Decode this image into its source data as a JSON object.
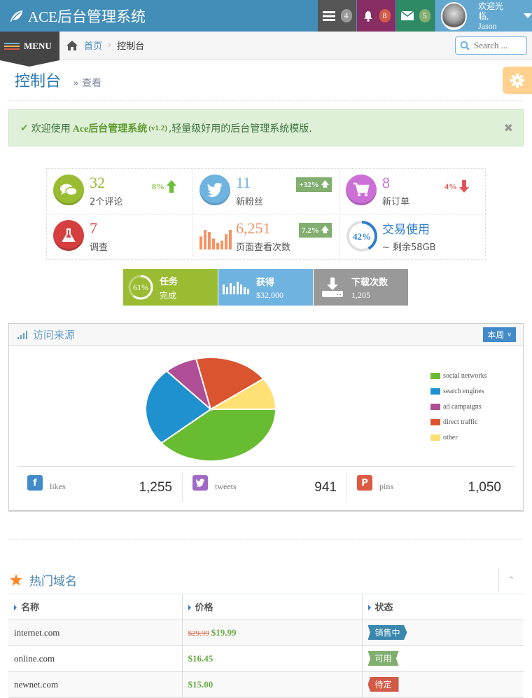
{
  "navbar": {
    "brand": "ACE后台管理系统",
    "tasks_count": "4",
    "notifications_count": "8",
    "messages_count": "5",
    "user_welcome": "欢迎光临,",
    "user_name": "Jason"
  },
  "sidebar": {
    "menu_label": "MENU"
  },
  "breadcrumb": {
    "home": "首页",
    "current": "控制台"
  },
  "search": {
    "placeholder": "Search ..."
  },
  "page_header": {
    "title": "控制台",
    "subtitle": "» 查看"
  },
  "alert": {
    "prefix": "欢迎使用",
    "brand": "Ace后台管理系统",
    "version": "(v1.2)",
    "suffix": ",轻量级好用的后台管理系统模版."
  },
  "infoboxes": [
    {
      "number": "32",
      "label": "2个评论",
      "stat": "8%",
      "trend": "up",
      "color": "#9abc32"
    },
    {
      "number": "11",
      "label": "新粉丝",
      "stat": "+32%",
      "trend": "up",
      "color": "#6fb3e0"
    },
    {
      "number": "8",
      "label": "新订单",
      "stat": "4%",
      "trend": "down",
      "color": "#cb6fd7"
    },
    {
      "number": "7",
      "label": "调查",
      "color": "#d53f40"
    },
    {
      "number": "6,251",
      "label": "页面查看次数",
      "stat": "7.2%",
      "trend": "up",
      "color": "#f79263",
      "sparkline": [
        6,
        9,
        8,
        5,
        3,
        4,
        7,
        9
      ]
    },
    {
      "title": "交易使用",
      "label": "~ 剩余58GB",
      "percent": "42%",
      "percent_value": 42,
      "color": "#307ecc"
    }
  ],
  "big_boxes": [
    {
      "title": "任务",
      "subtitle": "完成",
      "percent": "61%",
      "percent_value": 61,
      "color": "#9abc32"
    },
    {
      "title": "获得",
      "subtitle": "$32,000",
      "color": "#6fb3e0"
    },
    {
      "title": "下载次数",
      "subtitle": "1,205",
      "color": "#999999"
    }
  ],
  "traffic_widget": {
    "title": "访问来源",
    "range_button": "本周",
    "social": [
      {
        "label": "likes",
        "value": "1,255",
        "icon": "facebook-icon",
        "color": "#428bca"
      },
      {
        "label": "tweets",
        "value": "941",
        "icon": "twitter-icon",
        "color": "#a069c3"
      },
      {
        "label": "pins",
        "value": "1,050",
        "icon": "pinterest-icon",
        "color": "#dd5a43"
      }
    ]
  },
  "chart_data": {
    "type": "pie",
    "title": "访问来源",
    "legend_position": "right",
    "categories": [
      "social networks",
      "search engines",
      "ad campaigns",
      "direct traffic",
      "other"
    ],
    "values": [
      38.7,
      24.5,
      8.2,
      18.6,
      10
    ],
    "colors": [
      "#68bc31",
      "#2091cf",
      "#af4e96",
      "#da5430",
      "#fee074"
    ]
  },
  "domains": {
    "title": "热门域名",
    "columns": [
      "名称",
      "价格",
      "状态"
    ],
    "rows": [
      {
        "name": "internet.com",
        "old_price": "$29.99",
        "price": "$19.99",
        "status": "销售中",
        "status_color": "#3a87ad"
      },
      {
        "name": "online.com",
        "old_price": "",
        "price": "$16.45",
        "status": "可用",
        "status_color": "#82af6f"
      },
      {
        "name": "newnet.com",
        "old_price": "",
        "price": "$15.00",
        "status": "待定",
        "status_color": "#d15b47"
      }
    ]
  }
}
